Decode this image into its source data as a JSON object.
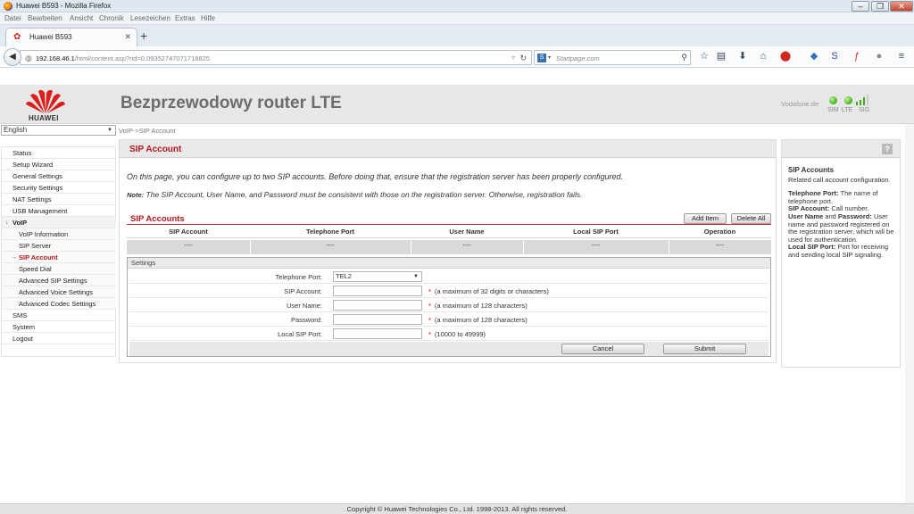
{
  "window": {
    "title": "Huawei B593 - Mozilla Firefox"
  },
  "menubar": [
    "Datei",
    "Bearbeiten",
    "Ansicht",
    "Chronik",
    "Lesezeichen",
    "Extras",
    "Hilfe"
  ],
  "tab": {
    "title": "Huawei B593"
  },
  "urlbar": {
    "host": "192.168.46.1",
    "path": "/html/content.asp?rid=0.09352747071718825"
  },
  "searchbar": {
    "placeholder": "Startpage.com"
  },
  "header": {
    "brand": "HUAWEI",
    "title": "Bezprzewodowy router LTE",
    "isp": "Vodafone.de",
    "indicators": [
      "SIM",
      "LTE",
      "SIG"
    ]
  },
  "language": {
    "selected": "English"
  },
  "sidebar": {
    "items": [
      {
        "label": "Status",
        "level": "top"
      },
      {
        "label": "Setup Wizard",
        "level": "top"
      },
      {
        "label": "General Settings",
        "level": "top"
      },
      {
        "label": "Security Settings",
        "level": "top"
      },
      {
        "label": "NAT Settings",
        "level": "top"
      },
      {
        "label": "USB Management",
        "level": "top"
      },
      {
        "label": "VoIP",
        "level": "group"
      },
      {
        "label": "VoIP Information",
        "level": "sub"
      },
      {
        "label": "SIP Server",
        "level": "sub"
      },
      {
        "label": "SIP Account",
        "level": "active"
      },
      {
        "label": "Speed Dial",
        "level": "sub"
      },
      {
        "label": "Advanced SIP Settings",
        "level": "sub"
      },
      {
        "label": "Advanced Voice Settings",
        "level": "sub"
      },
      {
        "label": "Advanced Codec Settings",
        "level": "sub"
      },
      {
        "label": "SMS",
        "level": "top"
      },
      {
        "label": "System",
        "level": "top"
      },
      {
        "label": "Logout",
        "level": "top"
      }
    ]
  },
  "breadcrumb": "VoIP->SIP Account",
  "main": {
    "title": "SIP Account",
    "intro": "On this page, you can configure up to two SIP accounts. Before doing that, ensure that the registration server has been properly configured.",
    "note_label": "Note:",
    "note": "The SIP Account, User Name, and Password must be consistent with those on the registration server. Otherwise, registration fails.",
    "section_title": "SIP Accounts",
    "add_label": "Add Item",
    "delete_all_label": "Delete All",
    "table": {
      "columns": [
        "SIP Account",
        "Telephone Port",
        "User Name",
        "Local SIP Port",
        "Operation"
      ],
      "rows": [
        [
          "----",
          "----",
          "----",
          "----",
          "----"
        ]
      ]
    },
    "settings": {
      "label": "Settings",
      "telephone_port_label": "Telephone Port:",
      "telephone_port_value": "TEL2",
      "sip_account_label": "SIP Account:",
      "sip_account_hint": "(a maximum of 32 digits or characters)",
      "user_name_label": "User Name:",
      "user_name_hint": "(a maximum of 128 characters)",
      "password_label": "Password:",
      "password_hint": "(a maximum of 128 characters)",
      "local_sip_port_label": "Local SIP Port:",
      "local_sip_port_hint": "(10000 to 49999)",
      "required_mark": "*",
      "cancel_label": "Cancel",
      "submit_label": "Submit"
    }
  },
  "help": {
    "q": "?",
    "title": "SIP Accounts",
    "desc": "Related call account configuration.",
    "tp_term": "Telephone Port:",
    "tp_desc": "The name of telephone port.",
    "sa_term": "SIP Account:",
    "sa_desc": "Call number.",
    "un_term": "User Name",
    "un_and": "and",
    "pw_term": "Password:",
    "unpw_desc": "User name and password registered on the registration server, which will be used for authentication.",
    "lsp_term": "Local SIP Port:",
    "lsp_desc": "Port for receiving and sending local SIP signaling."
  },
  "footer": "Copyright © Huawei Technologies Co., Ltd. 1998-2013. All rights reserved.",
  "colors": {
    "accent": "#b5171d",
    "led": "#3fae16"
  }
}
